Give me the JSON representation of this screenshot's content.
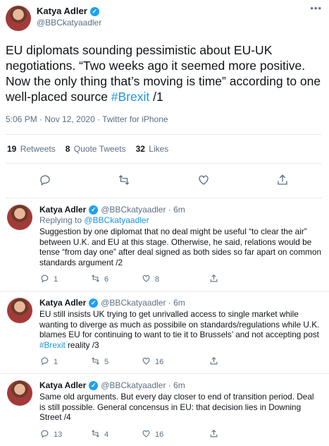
{
  "main": {
    "name": "Katya Adler",
    "handle": "@BBCkatyaadler",
    "text_plain": "EU diplomats sounding pessimistic about EU-UK negotiations. “Two weeks ago it seemed more positive. Now the only thing that’s moving is time” according to one well-placed source ",
    "hashtag": "#Brexit",
    "text_suffix": " /1",
    "meta": "5:06 PM · Nov 12, 2020 · Twitter for iPhone",
    "stats": [
      {
        "count": "19",
        "label": "Retweets"
      },
      {
        "count": "8",
        "label": "Quote Tweets"
      },
      {
        "count": "32",
        "label": "Likes"
      }
    ]
  },
  "replies": [
    {
      "name": "Katya Adler",
      "handle": "@BBCkatyaadler · 6m",
      "replying_prefix": "Replying to ",
      "replying_to": "@BBCkatyaadler",
      "text_a": "Suggestion by one diplomat that no deal might be useful “to clear the air” between U.K. and EU at this stage. Otherwise, he said, relations would be tense “from day one” after deal signed as both sides so far apart on common standards argument /2",
      "hashtag": "",
      "text_b": "",
      "replies": "1",
      "retweets": "6",
      "likes": "8"
    },
    {
      "name": "Katya Adler",
      "handle": "@BBCkatyaadler · 6m",
      "replying_prefix": "",
      "replying_to": "",
      "text_a": "EU still insists UK trying to get unrivalled access to single market while wanting to diverge as much as possibile on standards/regulations while U.K. blames EU for continuing to want to tie it to Brussels’ and not accepting post ",
      "hashtag": "#Brexit",
      "text_b": " reality /3",
      "replies": "1",
      "retweets": "5",
      "likes": "16"
    },
    {
      "name": "Katya Adler",
      "handle": "@BBCkatyaadler · 6m",
      "replying_prefix": "",
      "replying_to": "",
      "text_a": "Same old arguments. But every day closer to end of transition period. Deal is still possible. General concensus in EU: that decision lies in Downing Street /4",
      "hashtag": "",
      "text_b": "",
      "replies": "13",
      "retweets": "4",
      "likes": "16"
    }
  ],
  "icons": {
    "more": "more-icon",
    "reply": "reply-icon",
    "retweet": "retweet-icon",
    "like": "heart-icon",
    "share": "share-icon",
    "verified": "verified-icon"
  },
  "colors": {
    "link": "#1b95e0",
    "muted": "#5b7083",
    "verified": "#1da1f2"
  }
}
